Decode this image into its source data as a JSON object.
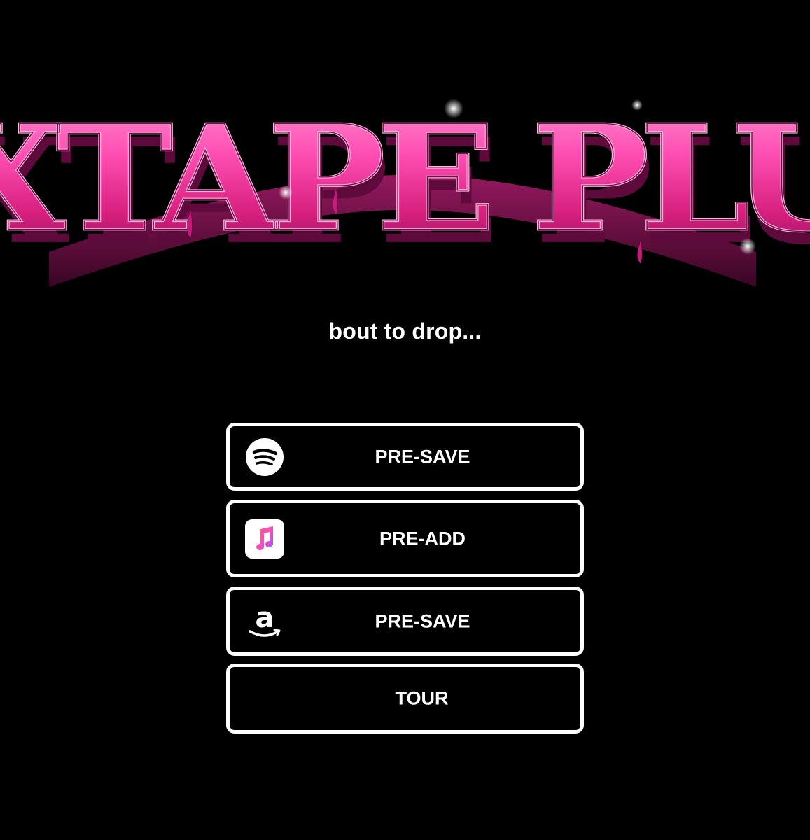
{
  "logo": {
    "text": "MIXTAPE PLUTO",
    "colors": {
      "face": "#ff4fb4",
      "face_dark": "#b0166f",
      "extrude": "#6a0d44",
      "outline": "#f9b7de"
    }
  },
  "tagline": "bout to drop...",
  "buttons": [
    {
      "label": "PRE-SAVE",
      "icon": "spotify-icon"
    },
    {
      "label": "PRE-ADD",
      "icon": "apple-music-icon"
    },
    {
      "label": "PRE-SAVE",
      "icon": "amazon-music-icon"
    },
    {
      "label": "TOUR",
      "icon": ""
    }
  ],
  "colors": {
    "background": "#000000",
    "text": "#ffffff",
    "button_border": "#ffffff"
  }
}
